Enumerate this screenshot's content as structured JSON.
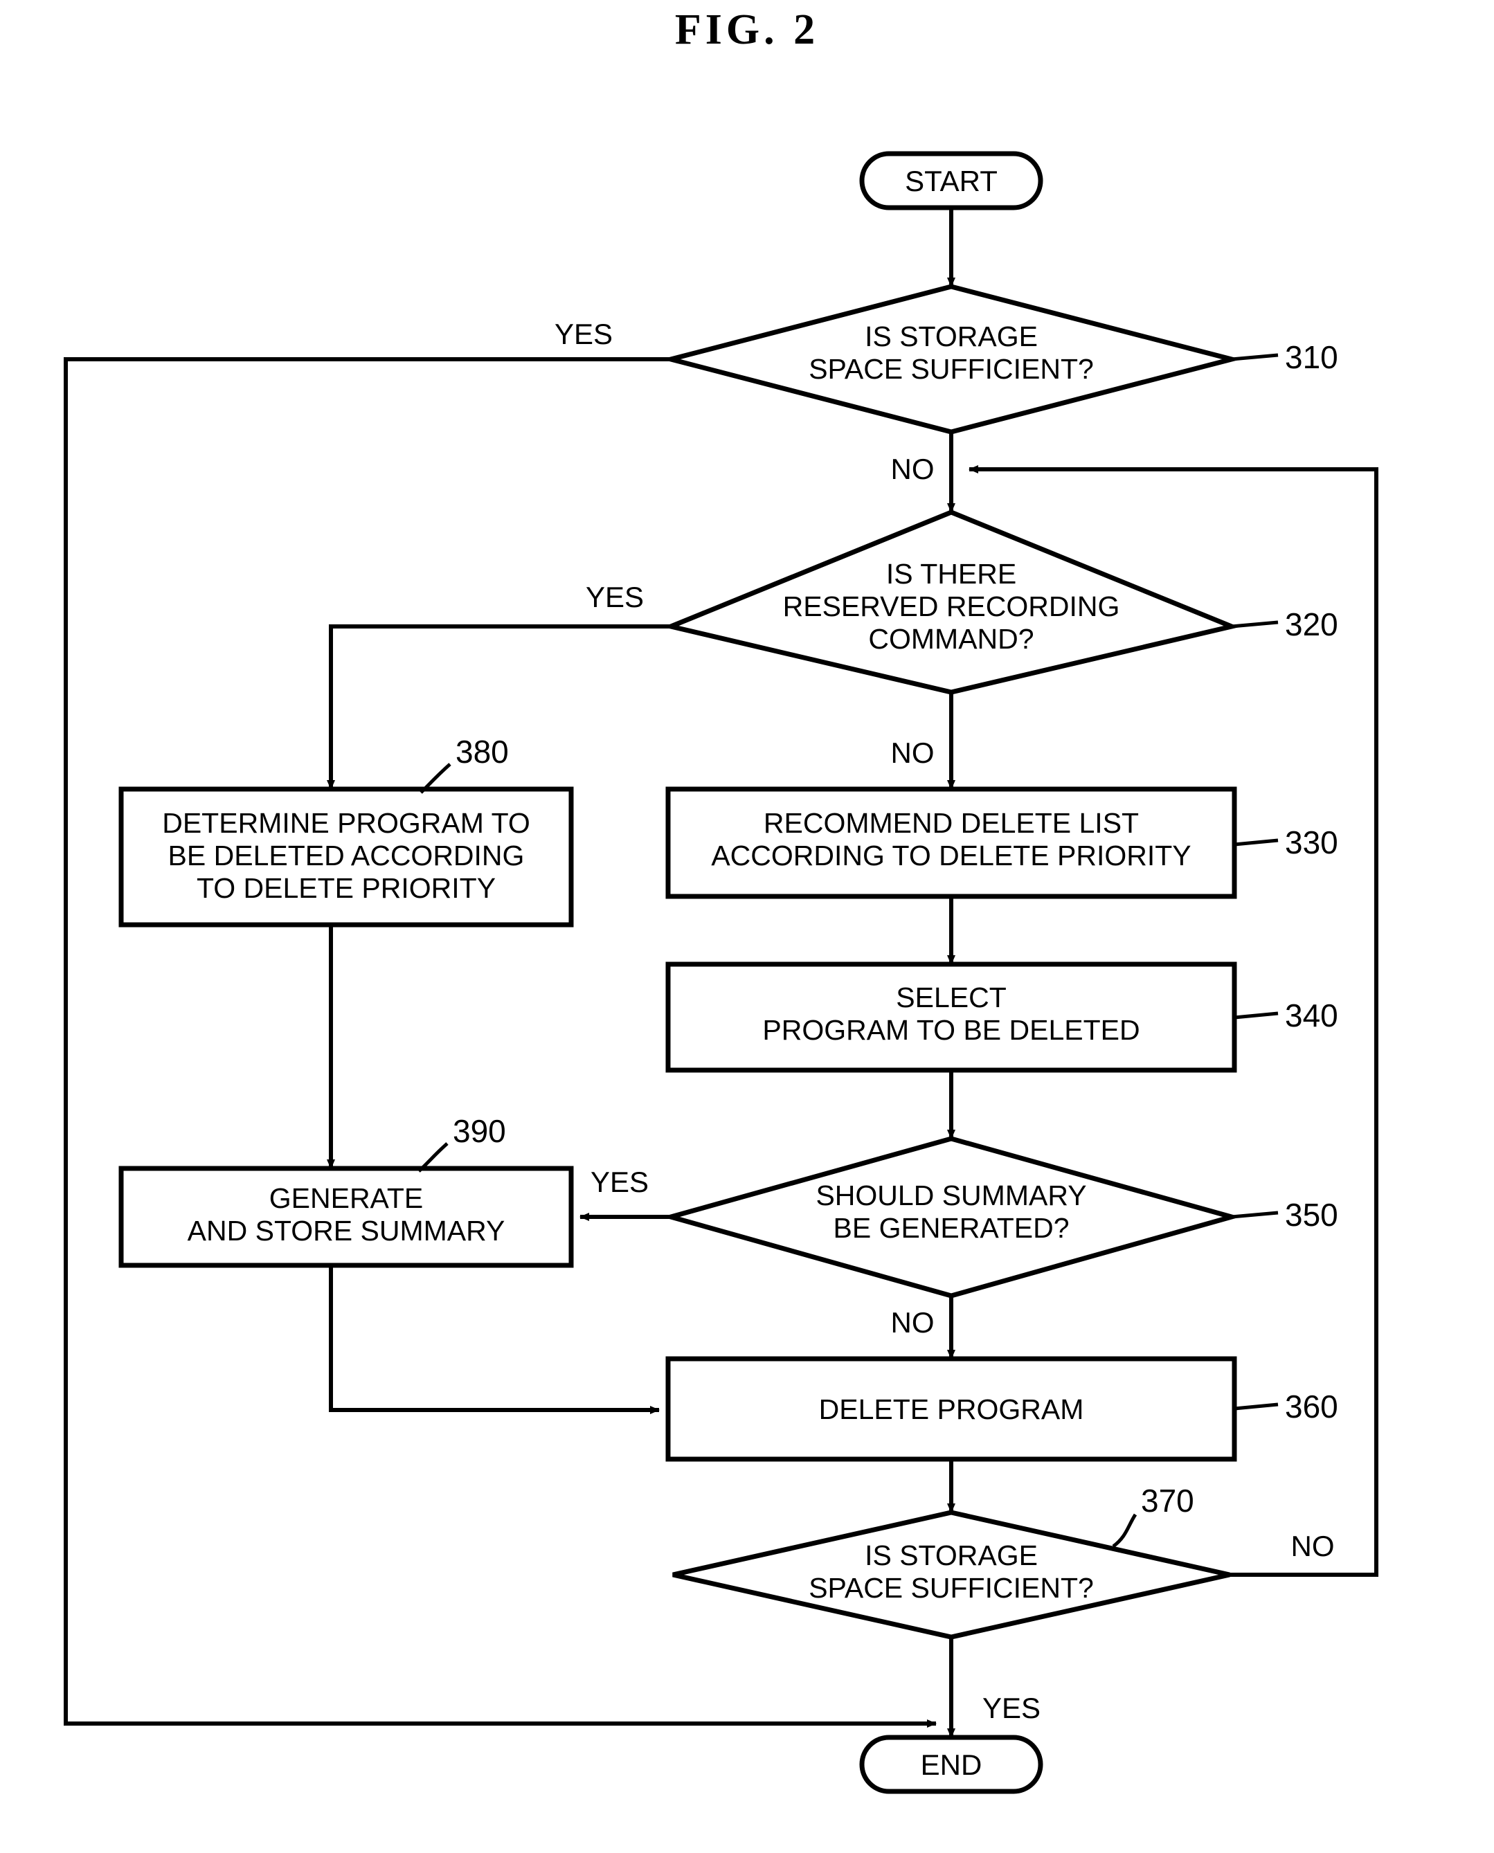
{
  "figure": {
    "title": "FIG. 2"
  },
  "nodes": {
    "start": {
      "label": "START",
      "type": "terminator"
    },
    "end": {
      "label": "END",
      "type": "terminator"
    },
    "d310": {
      "ref": "310",
      "type": "decision",
      "lines": [
        "IS STORAGE",
        "SPACE SUFFICIENT?"
      ]
    },
    "d320": {
      "ref": "320",
      "type": "decision",
      "lines": [
        "IS THERE",
        "RESERVED RECORDING",
        "COMMAND?"
      ]
    },
    "p330": {
      "ref": "330",
      "type": "process",
      "lines": [
        "RECOMMEND DELETE LIST",
        "ACCORDING TO DELETE PRIORITY"
      ]
    },
    "p340": {
      "ref": "340",
      "type": "process",
      "lines": [
        "SELECT",
        "PROGRAM TO BE DELETED"
      ]
    },
    "d350": {
      "ref": "350",
      "type": "decision",
      "lines": [
        "SHOULD SUMMARY",
        "BE GENERATED?"
      ]
    },
    "p360": {
      "ref": "360",
      "type": "process",
      "lines": [
        "DELETE PROGRAM"
      ]
    },
    "d370": {
      "ref": "370",
      "type": "decision",
      "lines": [
        "IS STORAGE",
        "SPACE SUFFICIENT?"
      ]
    },
    "p380": {
      "ref": "380",
      "type": "process",
      "lines": [
        "DETERMINE PROGRAM TO",
        "BE DELETED ACCORDING",
        "TO DELETE PRIORITY"
      ]
    },
    "p390": {
      "ref": "390",
      "type": "process",
      "lines": [
        "GENERATE",
        "AND STORE SUMMARY"
      ]
    }
  },
  "edge_labels": {
    "yes_310": "YES",
    "no_310": "NO",
    "yes_320": "YES",
    "no_320": "NO",
    "yes_350": "YES",
    "no_350": "NO",
    "no_370": "NO",
    "yes_370": "YES"
  },
  "colors": {
    "ink": "#000000",
    "paper": "#ffffff"
  }
}
